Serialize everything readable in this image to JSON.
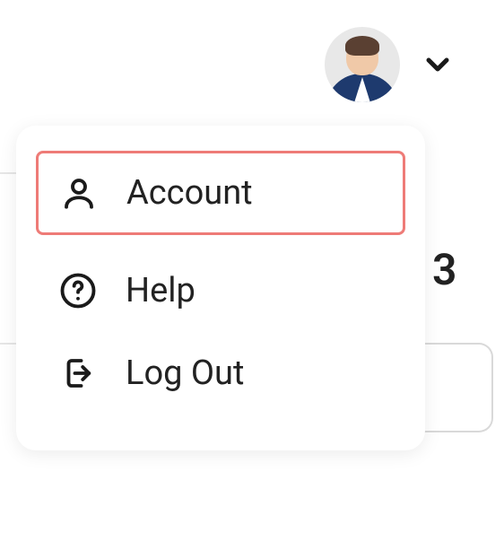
{
  "header": {
    "avatar_alt": "user-avatar"
  },
  "menu": {
    "items": [
      {
        "label": "Account",
        "highlighted": true
      },
      {
        "label": "Help",
        "highlighted": false
      },
      {
        "label": "Log Out",
        "highlighted": false
      }
    ]
  },
  "background": {
    "partial_number": "3"
  }
}
